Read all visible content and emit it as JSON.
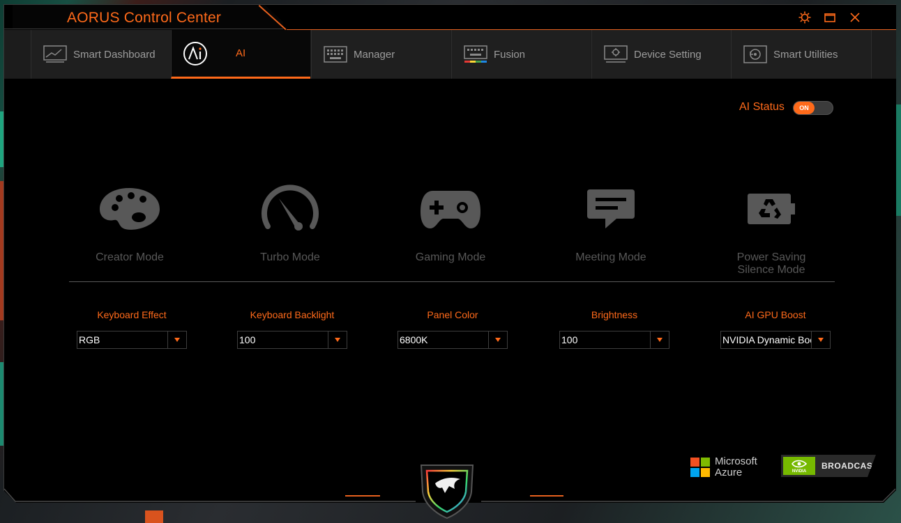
{
  "app": {
    "title": "AORUS Control Center",
    "accent_color": "#ff6a1a",
    "window_controls": [
      "gear-icon",
      "restore-icon",
      "close-icon"
    ]
  },
  "tabs": [
    {
      "label": "Smart Dashboard",
      "icon": "dashboard-icon",
      "active": false
    },
    {
      "label": "AI",
      "icon": "ai-icon",
      "active": true
    },
    {
      "label": "Manager",
      "icon": "keyboard-icon",
      "active": false
    },
    {
      "label": "Fusion",
      "icon": "rgb-keyboard-icon",
      "active": false
    },
    {
      "label": "Device Setting",
      "icon": "monitor-gear-icon",
      "active": false
    },
    {
      "label": "Smart Utilities",
      "icon": "utilities-icon",
      "active": false
    }
  ],
  "ai_status": {
    "label": "AI Status",
    "toggle_text": "ON",
    "on": true
  },
  "modes": [
    {
      "label": "Creator Mode",
      "icon": "palette-icon"
    },
    {
      "label": "Turbo Mode",
      "icon": "gauge-icon"
    },
    {
      "label": "Gaming Mode",
      "icon": "gamepad-icon"
    },
    {
      "label": "Meeting Mode",
      "icon": "chat-bubble-icon"
    },
    {
      "label": "Power Saving\nSilence Mode",
      "icon": "battery-recycle-icon"
    }
  ],
  "settings": [
    {
      "label": "Keyboard Effect",
      "value": "RGB"
    },
    {
      "label": "Keyboard Backlight",
      "value": "100"
    },
    {
      "label": "Panel Color",
      "value": "6800K"
    },
    {
      "label": "Brightness",
      "value": "100"
    },
    {
      "label": "AI GPU Boost",
      "value": "NVIDIA Dynamic Boost"
    }
  ],
  "partners": {
    "microsoft": {
      "line1": "Microsoft",
      "line2": "Azure"
    },
    "nvidia": {
      "badge": "NVIDIA",
      "text": "BROADCAST"
    }
  }
}
